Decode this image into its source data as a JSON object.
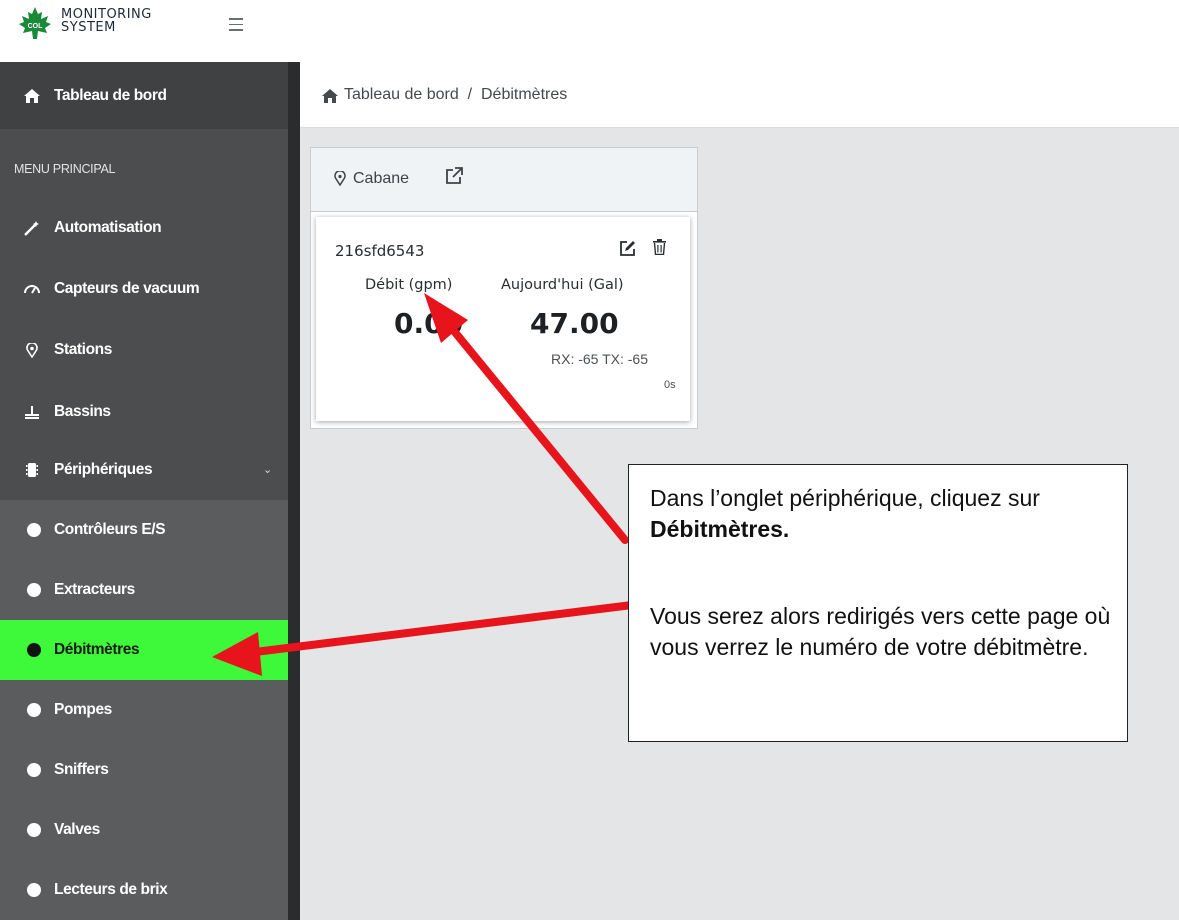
{
  "header": {
    "logo_text": "COL",
    "brand_line1": "MONITORING",
    "brand_line2": "SYSTEM",
    "menu_icon": "hamburger-menu-icon"
  },
  "sidebar": {
    "dashboard": {
      "label": "Tableau de bord",
      "icon": "home-icon"
    },
    "section_label": "MENU PRINCIPAL",
    "items": [
      {
        "label": "Automatisation",
        "icon": "magic-wand-icon"
      },
      {
        "label": "Capteurs de vacuum",
        "icon": "gauge-icon"
      },
      {
        "label": "Stations",
        "icon": "map-pin-icon"
      },
      {
        "label": "Bassins",
        "icon": "basin-icon"
      },
      {
        "label": "Périphériques",
        "icon": "chip-icon",
        "expanded": true
      }
    ],
    "sub_items": [
      {
        "label": "Contrôleurs E/S",
        "active": false
      },
      {
        "label": "Extracteurs",
        "active": false
      },
      {
        "label": "Débitmètres",
        "active": true
      },
      {
        "label": "Pompes",
        "active": false
      },
      {
        "label": "Sniffers",
        "active": false
      },
      {
        "label": "Valves",
        "active": false
      },
      {
        "label": "Lecteurs de brix",
        "active": false
      }
    ],
    "active_color": "#3ef83a"
  },
  "breadcrumb": {
    "text": "Tableau de bord  /  Débitmètres",
    "icon": "home-icon"
  },
  "card": {
    "title": "Cabane",
    "device_id": "216sfd6543",
    "flow_label": "Débit (gpm)",
    "flow_value": "0.00",
    "today_label": "Aujourd'hui (Gal)",
    "today_value": "47.00",
    "signal": "RX: -65 TX: -65",
    "age": "0s"
  },
  "callout": {
    "p1_text": "Dans l’onglet périphérique, cliquez sur ",
    "p1_bold": "Débitmètres.",
    "p2_text": "Vous serez alors redirigés vers cette page où vous verrez le numéro de votre débitmètre."
  },
  "annotation_color": "#e8141b"
}
